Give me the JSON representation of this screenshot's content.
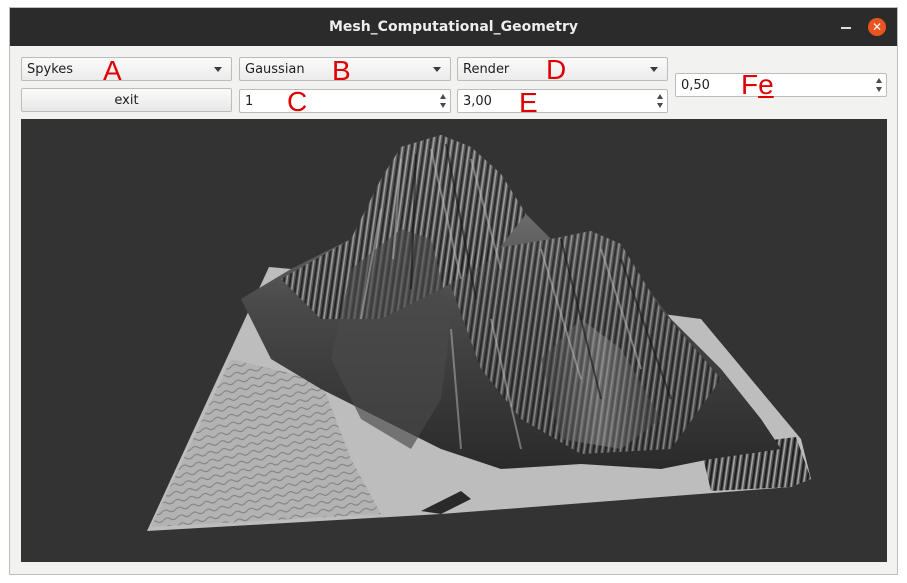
{
  "window": {
    "title": "Mesh_Computational_Geometry"
  },
  "titlebar": {
    "minimize_icon": "minimize-icon",
    "close_icon": "close-icon",
    "close_glyph": "✕",
    "close_color": "#e95420"
  },
  "controls": {
    "combo_a": "Spykes",
    "combo_b": "Gaussian",
    "combo_d": "Render",
    "exit_label": "exit",
    "spin_c": "1",
    "spin_e": "3,00",
    "spin_f": "0,50"
  },
  "annotations": {
    "a": "A",
    "b": "B",
    "c": "C",
    "d": "D",
    "e": "E",
    "f_main": "F",
    "f_sub": "e"
  },
  "colors": {
    "annotation": "#e00000",
    "viewport_bg": "#333333",
    "titlebar_bg": "#2b2b2b"
  },
  "viewport": {
    "content": "3D rendered terrain mesh (grayscale heightmap)"
  }
}
